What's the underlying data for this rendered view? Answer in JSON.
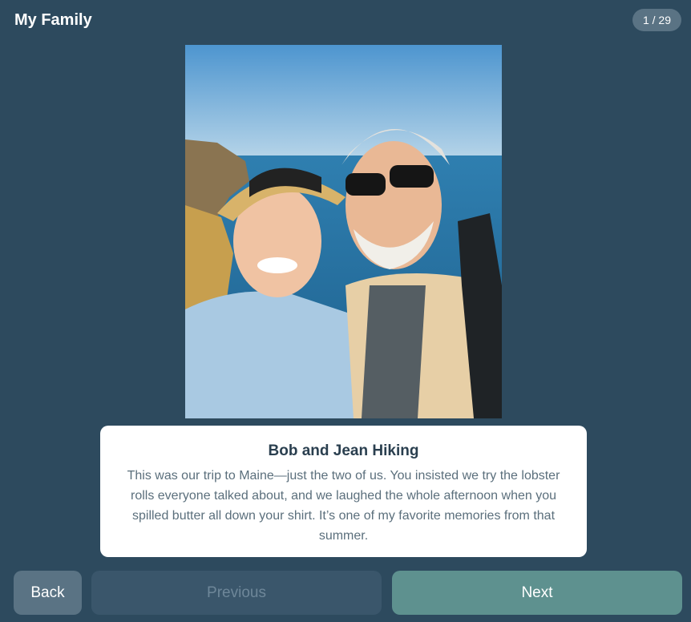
{
  "header": {
    "title": "My Family",
    "page_counter": "1 / 29"
  },
  "photo": {
    "subject": "selfie-photo"
  },
  "caption": {
    "title": "Bob and Jean Hiking",
    "text": "This was our trip to Maine—just the two of us. You insisted we try the lobster rolls everyone talked about, and we laughed the whole afternoon when you spilled butter all down your shirt. It’s one of my favorite memories from that summer."
  },
  "nav": {
    "back_label": "Back",
    "previous_label": "Previous",
    "next_label": "Next"
  },
  "colors": {
    "background": "#2d4a5e",
    "card": "#ffffff",
    "back_button": "#5a7384",
    "previous_button": "#3a566b",
    "next_button": "#5e918f"
  }
}
